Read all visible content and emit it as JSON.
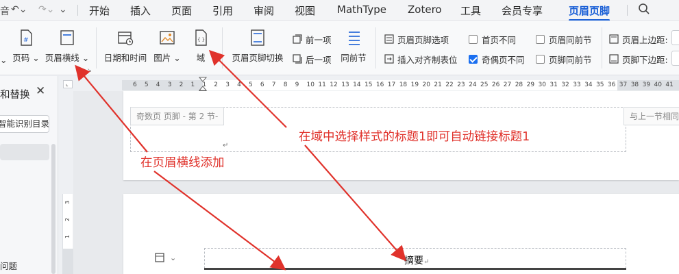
{
  "menubar": {
    "quick_left": "音",
    "items": [
      "开始",
      "插入",
      "页面",
      "引用",
      "审阅",
      "视图",
      "MathType",
      "Zotero",
      "工具",
      "会员专享",
      "页眉页脚"
    ],
    "active_index": 10
  },
  "ribbon": {
    "page_num": "页码",
    "header_line": "页眉横线",
    "date_time": "日期和时间",
    "picture": "图片",
    "field": "域",
    "switch": "页眉页脚切换",
    "prev": "前一项",
    "next": "后一项",
    "same_prev": "同前节",
    "options": "页眉页脚选项",
    "insert_align": "插入对齐制表位",
    "first_diff": "首页不同",
    "first_diff_checked": false,
    "odd_even_diff": "奇偶页不同",
    "odd_even_checked": true,
    "header_same_prev": "页眉同前节",
    "header_same_checked": false,
    "footer_same_prev": "页脚同前节",
    "footer_same_checked": false,
    "header_top": "页眉上边距:",
    "footer_bottom": "页脚下边距:"
  },
  "leftpanel": {
    "title": "和替换",
    "smart_toc": "智能识别目录",
    "item": "问题"
  },
  "ruler": {
    "ticks": [
      "6",
      "5",
      "4",
      "3",
      "2",
      "1",
      "1",
      "2",
      "3",
      "4",
      "5",
      "6",
      "7",
      "8",
      "9",
      "10",
      "11",
      "12",
      "13",
      "14",
      "15",
      "16",
      "17",
      "18",
      "19",
      "20",
      "21",
      "22",
      "23",
      "24",
      "25",
      "26",
      "27",
      "28",
      "29",
      "30",
      "31",
      "32",
      "33",
      "34",
      "35",
      "36",
      "37",
      "38",
      "39",
      "40",
      "41"
    ],
    "vticks": [
      "3",
      "2",
      "1"
    ]
  },
  "document": {
    "footer_label": "奇数页 页脚  - 第 2 节-",
    "same_as_prev": "与上一节相同",
    "para_mark": "↵",
    "header_text": "摘要",
    "header_para_mark": "↵"
  },
  "annotations": {
    "note_field": "在域中选择样式的标题1即可自动链接标题1",
    "note_line": "在页眉横线添加"
  },
  "colors": {
    "accent": "#1a5fd6",
    "annotation": "#e0322b"
  }
}
